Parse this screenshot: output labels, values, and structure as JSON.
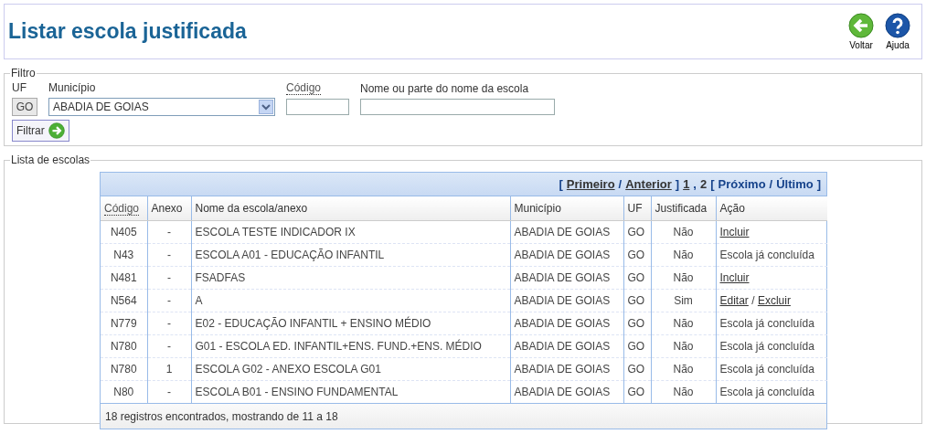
{
  "header": {
    "title": "Listar escola justificada",
    "actions": [
      {
        "kind": "back",
        "label": "Voltar"
      },
      {
        "kind": "help",
        "label": "Ajuda"
      }
    ]
  },
  "filter": {
    "legend": "Filtro",
    "uf_label": "UF",
    "uf_value": "GO",
    "municipio_label": "Município",
    "municipio_value": "ABADIA DE GOIAS",
    "codigo_label": "Código",
    "nome_label": "Nome ou parte do nome da escola",
    "button": "Filtrar"
  },
  "list": {
    "legend": "Lista de escolas",
    "pager": [
      {
        "kind": "text",
        "text": "["
      },
      {
        "kind": "link",
        "text": "Primeiro"
      },
      {
        "kind": "text",
        "text": "/"
      },
      {
        "kind": "link",
        "text": "Anterior"
      },
      {
        "kind": "text",
        "text": "]"
      },
      {
        "kind": "link",
        "text": "1"
      },
      {
        "kind": "text",
        "text": ","
      },
      {
        "kind": "current",
        "text": "2"
      },
      {
        "kind": "text",
        "text": "["
      },
      {
        "kind": "text",
        "text": "Próximo"
      },
      {
        "kind": "text",
        "text": "/"
      },
      {
        "kind": "text",
        "text": "Último"
      },
      {
        "kind": "text",
        "text": "]"
      }
    ],
    "columns": [
      "Código",
      "Anexo",
      "Nome da escola/anexo",
      "Município",
      "UF",
      "Justificada",
      "Ação"
    ],
    "rows": [
      {
        "codigo": "N405",
        "anexo": "-",
        "nome": "ESCOLA TESTE INDICADOR IX",
        "municipio": "ABADIA DE GOIAS",
        "uf": "GO",
        "justificada": "Não",
        "acao": [
          {
            "kind": "link",
            "text": "Incluir"
          }
        ]
      },
      {
        "codigo": "N43",
        "anexo": "-",
        "nome": "ESCOLA A01 - EDUCAÇÃO INFANTIL",
        "municipio": "ABADIA DE GOIAS",
        "uf": "GO",
        "justificada": "Não",
        "acao": [
          {
            "kind": "text",
            "text": "Escola já concluída"
          }
        ]
      },
      {
        "codigo": "N481",
        "anexo": "-",
        "nome": "FSADFAS",
        "municipio": "ABADIA DE GOIAS",
        "uf": "GO",
        "justificada": "Não",
        "acao": [
          {
            "kind": "link",
            "text": "Incluir"
          }
        ]
      },
      {
        "codigo": "N564",
        "anexo": "-",
        "nome": "A",
        "municipio": "ABADIA DE GOIAS",
        "uf": "GO",
        "justificada": "Sim",
        "acao": [
          {
            "kind": "link",
            "text": "Editar"
          },
          {
            "kind": "text",
            "text": "/"
          },
          {
            "kind": "link",
            "text": "Excluir"
          }
        ]
      },
      {
        "codigo": "N779",
        "anexo": "-",
        "nome": "E02 - EDUCAÇÃO INFANTIL + ENSINO MÉDIO",
        "municipio": "ABADIA DE GOIAS",
        "uf": "GO",
        "justificada": "Não",
        "acao": [
          {
            "kind": "text",
            "text": "Escola já concluída"
          }
        ]
      },
      {
        "codigo": "N780",
        "anexo": "-",
        "nome": "G01 - ESCOLA ED. INFANTIL+ENS. FUND.+ENS. MÉDIO",
        "municipio": "ABADIA DE GOIAS",
        "uf": "GO",
        "justificada": "Não",
        "acao": [
          {
            "kind": "text",
            "text": "Escola já concluída"
          }
        ]
      },
      {
        "codigo": "N780",
        "anexo": "1",
        "nome": "ESCOLA G02 - ANEXO ESCOLA G01",
        "municipio": "ABADIA DE GOIAS",
        "uf": "GO",
        "justificada": "Não",
        "acao": [
          {
            "kind": "text",
            "text": "Escola já concluída"
          }
        ]
      },
      {
        "codigo": "N80",
        "anexo": "-",
        "nome": "ESCOLA B01 - ENSINO FUNDAMENTAL",
        "municipio": "ABADIA DE GOIAS",
        "uf": "GO",
        "justificada": "Não",
        "acao": [
          {
            "kind": "text",
            "text": "Escola já concluída"
          }
        ]
      }
    ],
    "footer": "18 registros encontrados, mostrando de 11 a 18"
  }
}
